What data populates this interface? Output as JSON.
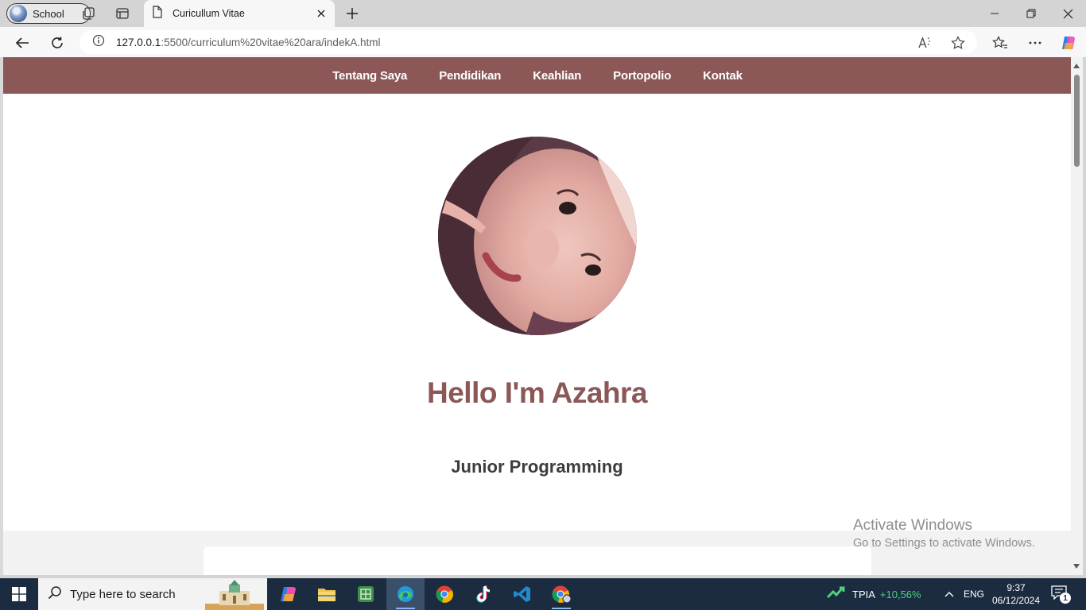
{
  "browser": {
    "profile_name": "School",
    "tab_title": "Curicullum Vitae",
    "url_host": "127.0.0.1",
    "url_path": ":5500/curriculum%20vitae%20ara/indekA.html"
  },
  "navbar": {
    "items": [
      "Tentang Saya",
      "Pendidikan",
      "Keahlian",
      "Portopolio",
      "Kontak"
    ]
  },
  "hero": {
    "title": "Hello I'm Azahra",
    "subtitle": "Junior Programming"
  },
  "watermark": {
    "line1": "Activate Windows",
    "line2": "Go to Settings to activate Windows."
  },
  "taskbar": {
    "search_placeholder": "Type here to search",
    "stock_name": "TPIA",
    "stock_change": "+10,56%",
    "language": "ENG",
    "time": "9:37",
    "date": "06/12/2024",
    "notification_count": "1"
  },
  "colors": {
    "accent": "#8b5757",
    "taskbar": "#1c2c40"
  }
}
